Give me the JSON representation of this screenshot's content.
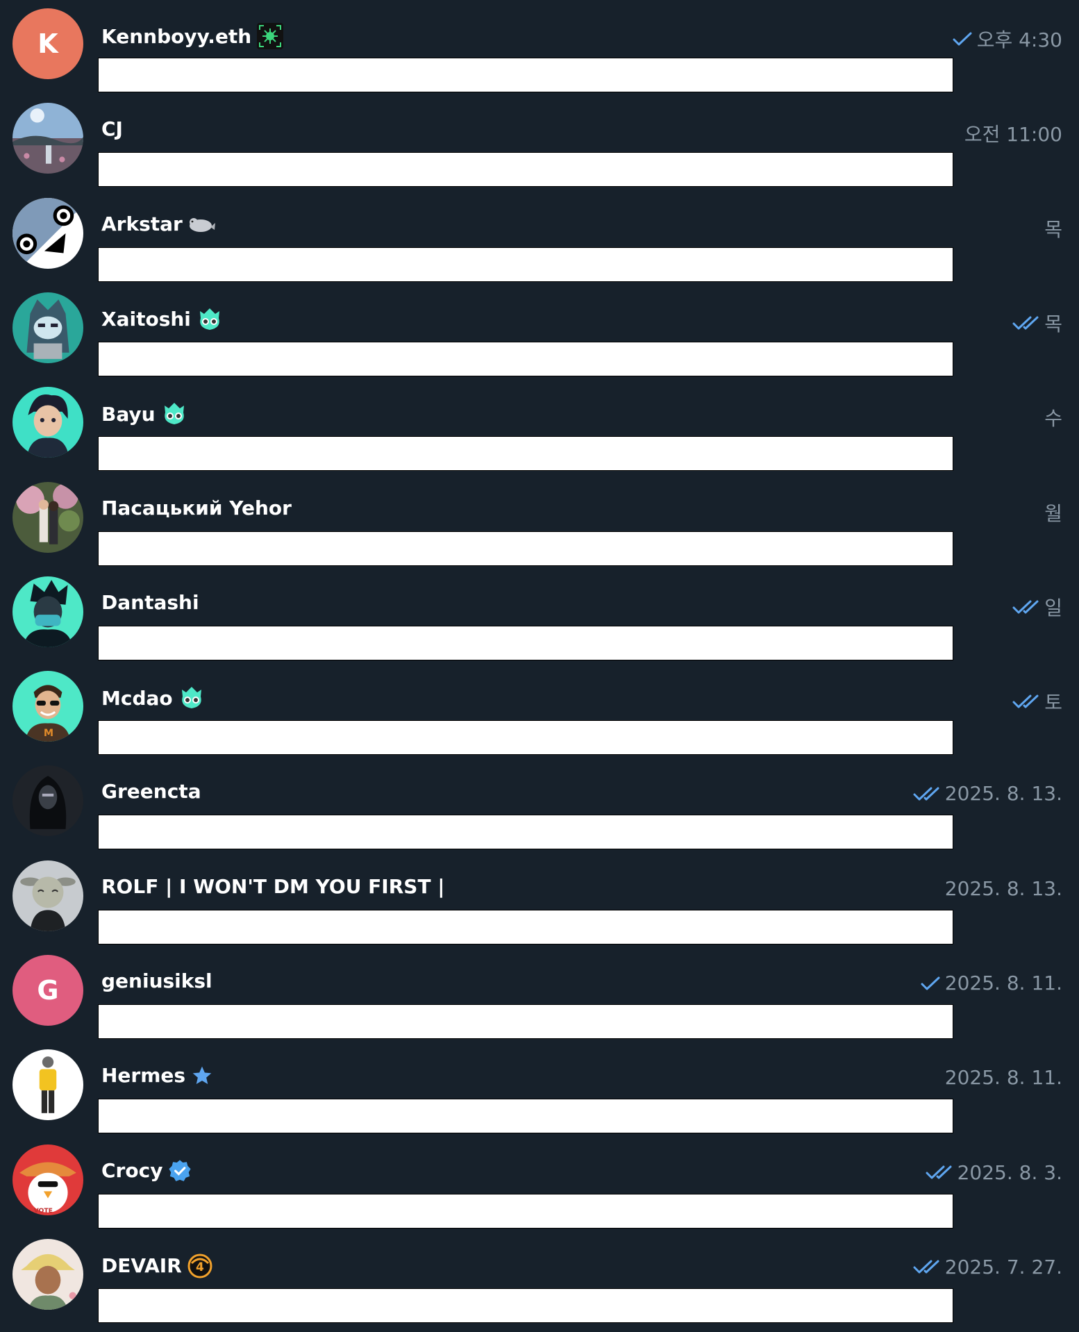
{
  "colors": {
    "background": "#17212b",
    "name": "#ffffff",
    "meta": "#8a98a5",
    "check": "#5fa6f0",
    "preview": "#ffffff"
  },
  "chats": [
    {
      "name": "Kennboyy.eth",
      "badge": "sparkle-badge-icon",
      "time": "오후 4:30",
      "read": "single",
      "avatar": {
        "type": "initial",
        "letter": "K",
        "color": "#e8775e"
      }
    },
    {
      "name": "CJ",
      "badge": "",
      "time": "오전 11:00",
      "read": "none",
      "avatar": {
        "type": "photo",
        "icon": "landscape-photo-avatar"
      }
    },
    {
      "name": "Arkstar",
      "badge": "seal-emoji-icon",
      "time": "목",
      "read": "none",
      "avatar": {
        "type": "art",
        "icon": "cartoon-face-avatar"
      }
    },
    {
      "name": "Xaitoshi",
      "badge": "alien-emoji-icon",
      "time": "목",
      "read": "double",
      "avatar": {
        "type": "art",
        "icon": "hooded-character-avatar"
      }
    },
    {
      "name": "Bayu",
      "badge": "alien-emoji-icon",
      "time": "수",
      "read": "none",
      "avatar": {
        "type": "art",
        "icon": "anime-boy-avatar"
      }
    },
    {
      "name": "Пасацький Yehor",
      "badge": "",
      "time": "월",
      "read": "none",
      "avatar": {
        "type": "photo",
        "icon": "couple-photo-avatar"
      }
    },
    {
      "name": "Dantashi",
      "badge": "",
      "time": "일",
      "read": "double",
      "avatar": {
        "type": "art",
        "icon": "masked-ninja-avatar"
      }
    },
    {
      "name": "Mcdao",
      "badge": "alien-emoji-icon",
      "time": "토",
      "read": "double",
      "avatar": {
        "type": "art",
        "icon": "sunglasses-man-avatar"
      }
    },
    {
      "name": "Greencta",
      "badge": "",
      "time": "2025. 8. 13.",
      "read": "double",
      "avatar": {
        "type": "art",
        "icon": "hooded-mask-avatar"
      }
    },
    {
      "name": "ROLF | I WON'T DM YOU FIRST |",
      "badge": "",
      "time": "2025. 8. 13.",
      "read": "none",
      "avatar": {
        "type": "art",
        "icon": "bull-head-avatar"
      }
    },
    {
      "name": "geniusiksl",
      "badge": "",
      "time": "2025. 8. 11.",
      "read": "single",
      "avatar": {
        "type": "initial",
        "letter": "G",
        "color": "#e05d7f"
      }
    },
    {
      "name": "Hermes",
      "badge": "star-badge-icon",
      "time": "2025. 8. 11.",
      "read": "none",
      "avatar": {
        "type": "art",
        "icon": "standing-figure-avatar"
      }
    },
    {
      "name": "Crocy",
      "badge": "verified-badge-icon",
      "time": "2025. 8. 3.",
      "read": "double",
      "avatar": {
        "type": "art",
        "icon": "penguin-hat-avatar"
      }
    },
    {
      "name": "DEVAIR",
      "badge": "four-coin-badge-icon",
      "time": "2025. 7. 27.",
      "read": "double",
      "avatar": {
        "type": "art",
        "icon": "bucket-hat-avatar"
      }
    }
  ]
}
